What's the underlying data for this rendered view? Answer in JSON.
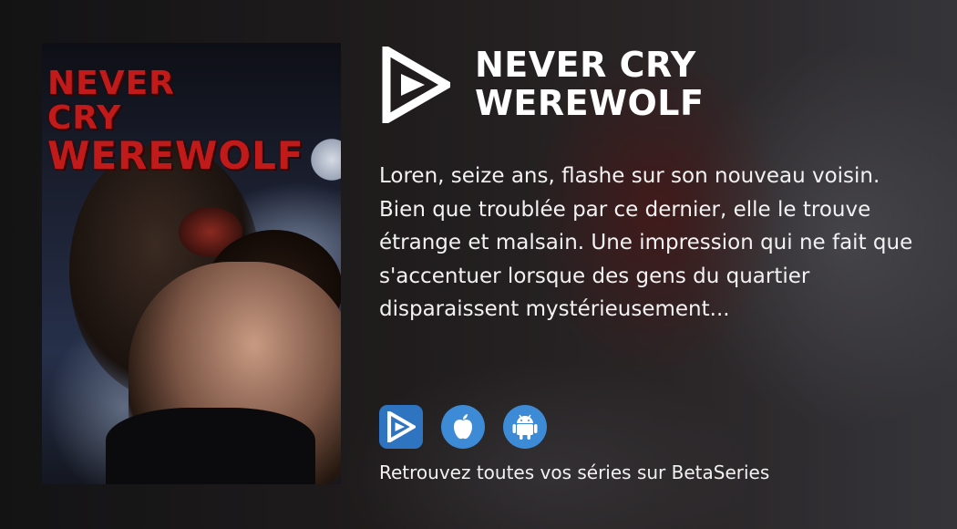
{
  "poster": {
    "title_line1": "NEVER CRY",
    "title_line2": "WEREWOLF"
  },
  "show": {
    "title_line1": "NEVER CRY",
    "title_line2": "WEREWOLF",
    "description": "Loren, seize ans, flashe sur son nouveau voisin. Bien que troublée par ce dernier, elle le trouve étrange et malsain. Une impression qui ne fait que s'accentuer lorsque des gens du quartier disparaissent mystérieusement..."
  },
  "apps": [
    {
      "icon": "betaseries-icon",
      "color": "#2f74c0"
    },
    {
      "icon": "apple-icon",
      "color": "#3d8bd6"
    },
    {
      "icon": "android-icon",
      "color": "#3d8bd6"
    }
  ],
  "footer": {
    "text": "Retrouvez toutes vos séries sur BetaSeries"
  }
}
